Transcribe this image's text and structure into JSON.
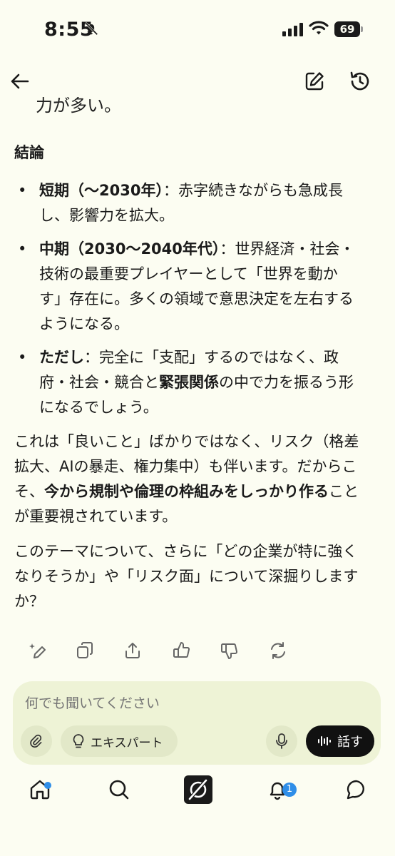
{
  "status": {
    "time": "8:55",
    "battery": "69"
  },
  "partial_line": "力が多い。",
  "content": {
    "heading": "結論",
    "bullets": [
      {
        "bold": "短期（〜2030年）",
        "rest1": "：赤字続きながらも急成長",
        "rest2": "し、影響力を拡大。"
      },
      {
        "bold": "中期（2030〜2040年代）",
        "rest1": "：世界経済・社会・",
        "line2": "技術の最重要プレイヤーとして「世界を動か",
        "line3": "す」存在に。多くの領域で意思決定を左右する",
        "line4": "ようになる。"
      },
      {
        "bold": "ただし",
        "rest1": "：完全に「支配」するのではなく、政",
        "line2a": "府・社会・競合と",
        "line2bold": "緊張関係",
        "line2b": "の中で力を振るう形",
        "line3": "になるでしょう。"
      }
    ],
    "para1": {
      "line1": "これは「良いこと」ばかりではなく、リスク（格差",
      "line2": "拡大、AIの暴走、権力集中）も伴います。だからこ",
      "line3a": "そ、",
      "line3bold": "今から規制や倫理の枠組みをしっかり作る",
      "line3b": "こと",
      "line4": "が重要視されています。"
    },
    "para2": {
      "line1": "このテーマについて、さらに「どの企業が特に強く",
      "line2": "なりそうか」や「リスク面」について深掘りします",
      "line3": "か？"
    }
  },
  "composer": {
    "placeholder": "何でも聞いてください",
    "expert_label": "エキスパート",
    "talk_label": "話す"
  },
  "tabbar": {
    "notification_count": "1"
  },
  "colors": {
    "background": "#fcfdf2",
    "composer": "#eef3d6",
    "accent": "#2f8ee8"
  }
}
